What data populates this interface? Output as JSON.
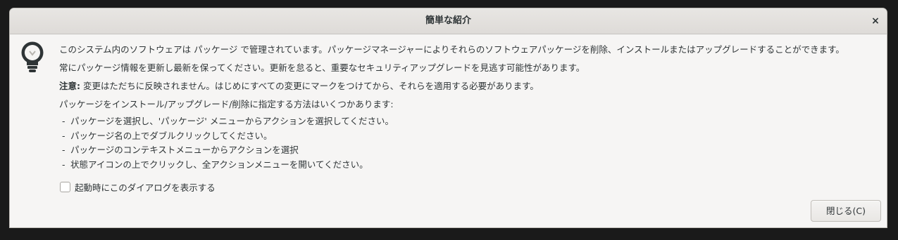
{
  "window": {
    "title": "簡単な紹介",
    "close_glyph": "×"
  },
  "icon": {
    "name": "lightbulb-icon"
  },
  "content": {
    "paragraph1": "このシステム内のソフトウェアは  パッケージ で管理されています。パッケージマネージャーによりそれらのソフトウェアパッケージを削除、インストールまたはアップグレードすることができます。",
    "paragraph2": "常にパッケージ情報を更新し最新を保ってください。更新を怠ると、重要なセキュリティアップグレードを見逃す可能性があります。",
    "note_label": "注意:",
    "note_text": " 変更はただちに反映されません。はじめにすべての変更にマークをつけてから、それらを適用する必要があります。",
    "methods_intro": "パッケージをインストール/アップグレード/削除に指定する方法はいくつかあります:",
    "methods": [
      "パッケージを選択し、'パッケージ' メニューからアクションを選択してください。",
      "パッケージ名の上でダブルクリックしてください。",
      "パッケージのコンテキストメニューからアクションを選択",
      "状態アイコンの上でクリックし、全アクションメニューを開いてください。"
    ],
    "list_dash": "-"
  },
  "startup_checkbox": {
    "label": "起動時にこのダイアログを表示する",
    "checked": false
  },
  "footer": {
    "close_button_label": "閉じる(C)"
  },
  "colors": {
    "window_bg": "#f6f5f4",
    "titlebar_bg": "#e8e6e3",
    "text": "#2e3436",
    "icon": "#2e3436"
  }
}
